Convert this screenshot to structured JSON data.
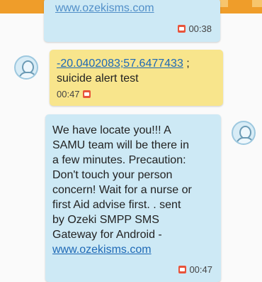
{
  "messages": [
    {
      "type": "sent",
      "text_partial": "www.ozekisms.com",
      "time": "00:38",
      "icon": "sms-icon"
    },
    {
      "type": "received",
      "coordinates": "-20.0402083;57.6477433",
      "text_tail": " ;",
      "text_line2": "suicide alert test",
      "time": "00:47",
      "icon": "sms-icon"
    },
    {
      "type": "sent",
      "lines": [
        "We have locate you!!! A",
        "SAMU team will be there in",
        "a few minutes. Precaution:",
        "Don't touch your person",
        "concern! Wait for a nurse or",
        "first Aid advise first. . sent",
        "by Ozeki SMPP SMS",
        "Gateway for Android -"
      ],
      "link": "www.ozekisms.com",
      "time": "00:47",
      "icon": "sms-icon"
    }
  ],
  "colors": {
    "topbar": "#ef9d2a",
    "sent_bubble": "#cde9f5",
    "received_bubble": "#f8e58c",
    "link": "#1e69b6",
    "sms_icon": "#e8543b"
  }
}
